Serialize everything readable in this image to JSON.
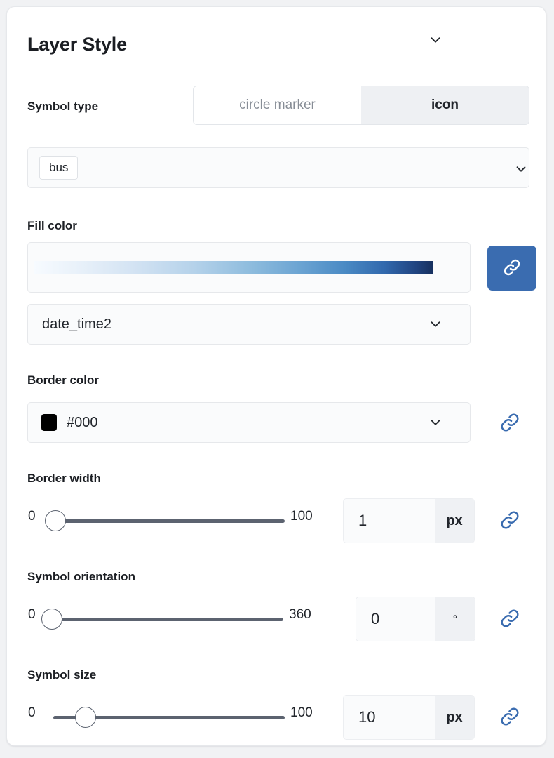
{
  "panel": {
    "title": "Layer Style"
  },
  "symbol_type": {
    "label": "Symbol type",
    "options": [
      "circle marker",
      "icon"
    ],
    "selected": "icon"
  },
  "icon_picker": {
    "chips": [
      "bus"
    ],
    "chevron_icon": "chevron-down-icon"
  },
  "fill_color": {
    "label": "Fill color",
    "gradient_name": "blues-sequential",
    "gradient_stops": [
      "#f7fbff",
      "#d3e3f3",
      "#8cbbdd",
      "#4a8ac4",
      "#20437f",
      "#17305f"
    ],
    "chevron_icon": "chevron-down-icon",
    "link_button": {
      "icon": "link-icon",
      "active": true,
      "color": "#3a6cb0"
    },
    "data_field": "date_time2",
    "data_field_chevron_icon": "chevron-down-icon"
  },
  "border_color": {
    "label": "Border color",
    "swatch_color": "#000000",
    "value": "#000",
    "chevron_icon": "chevron-down-icon",
    "link_icon": "link-icon"
  },
  "border_width": {
    "label": "Border width",
    "min": "0",
    "max": "100",
    "value": "1",
    "unit": "px",
    "fill_percent": 1,
    "link_icon": "link-icon"
  },
  "symbol_orientation": {
    "label": "Symbol orientation",
    "min": "0",
    "max": "360",
    "value": "0",
    "unit": "°",
    "fill_percent": 0,
    "link_icon": "link-icon"
  },
  "symbol_size": {
    "label": "Symbol size",
    "min": "0",
    "max": "100",
    "value": "10",
    "unit": "px",
    "fill_percent": 10,
    "link_icon": "link-icon"
  },
  "colors": {
    "accent": "#3a6cb0",
    "panel_bg": "#ffffff",
    "page_bg": "#f1f2f4",
    "track": "#5c6370",
    "text": "#1b1e23",
    "muted_text": "#878d96"
  }
}
